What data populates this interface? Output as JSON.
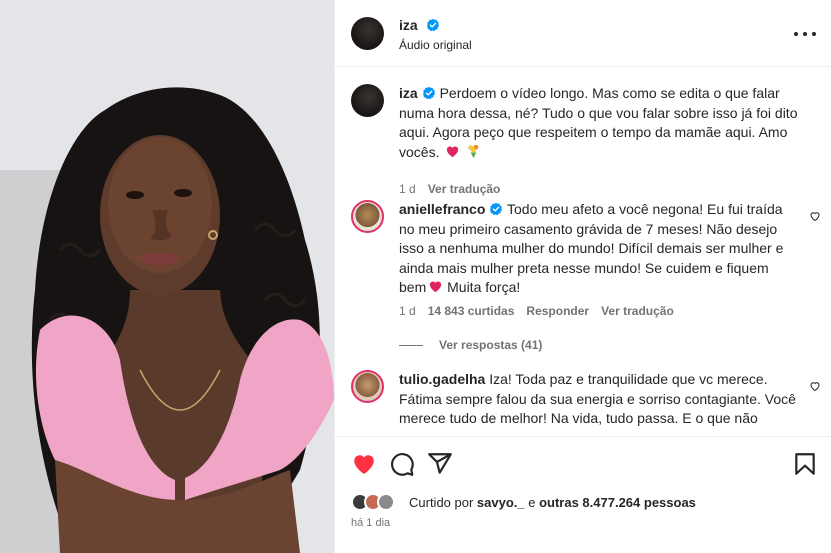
{
  "header": {
    "username": "iza",
    "audio_label": "Áudio original"
  },
  "caption": {
    "username": "iza",
    "text": "Perdoem o vídeo longo. Mas como se edita o que falar numa hora dessa, né? Tudo o que vou falar sobre isso já foi dito aqui. Agora peço que respeitem o tempo da mamãe aqui. Amo vocês.",
    "time": "1 d",
    "translate": "Ver tradução"
  },
  "comments": [
    {
      "username": "aniellefranco",
      "text_part1": "Todo meu afeto a você negona! Eu fui traída no meu primeiro casamento grávida de 7 meses! Não desejo isso a nenhuma mulher do mundo! Difícil demais ser mulher e ainda mais mulher preta nesse mundo! Se cuidem e fiquem bem",
      "text_part2": "Muita força!",
      "time": "1 d",
      "likes": "14 843 curtidas",
      "reply": "Responder",
      "translate": "Ver tradução",
      "view_replies": "Ver respostas (41)"
    },
    {
      "username": "tulio.gadelha",
      "text": "Iza! Toda paz e tranquilidade que vc merece. Fátima sempre falou da sua energia e sorriso contagiante. Você merece tudo de melhor! Na vida, tudo passa. E o que não"
    }
  ],
  "footer": {
    "liked_prefix": "Curtido por ",
    "liked_user": "savyo._",
    "liked_mid": " e ",
    "liked_others": "outras 8.477.264 pessoas",
    "time": "há 1 dia"
  },
  "icons": [
    "verified-icon",
    "more-options-icon",
    "heart-icon",
    "comment-icon",
    "share-icon",
    "save-icon"
  ],
  "colors": {
    "like_red": "#ff3040",
    "verified_blue": "#0095f6",
    "muted": "#737373"
  }
}
